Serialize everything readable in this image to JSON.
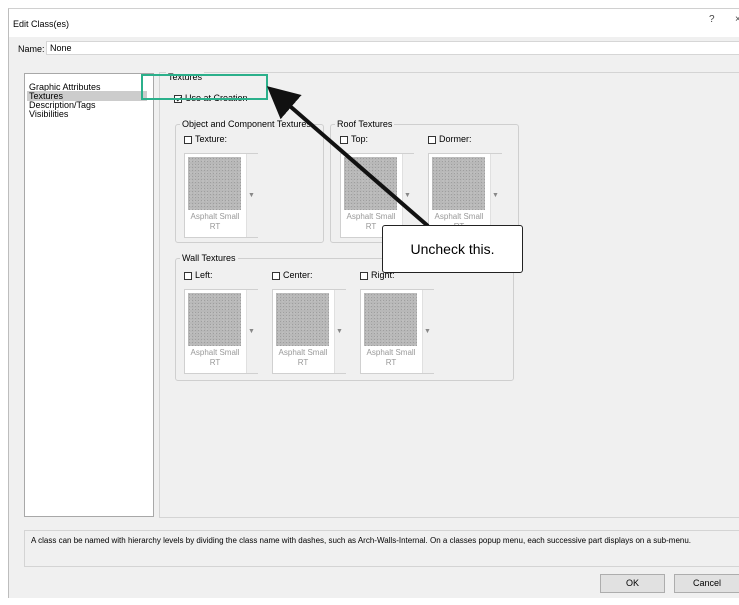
{
  "dialog": {
    "title": "Edit Class(es)",
    "help_label": "?",
    "close_label": "×"
  },
  "name_field": {
    "label": "Name:",
    "value": "None"
  },
  "categories": [
    {
      "label": "Graphic Attributes",
      "selected": false
    },
    {
      "label": "Textures",
      "selected": true
    },
    {
      "label": "Description/Tags",
      "selected": false
    },
    {
      "label": "Visibilities",
      "selected": false
    }
  ],
  "textures": {
    "group_label": "Textures",
    "use_at_creation": {
      "label": "Use at Creation",
      "checked": true
    },
    "object_component": {
      "group_label": "Object and Component Textures",
      "texture": {
        "label": "Texture:",
        "checked": false,
        "name_line1": "Asphalt Small",
        "name_line2": "RT"
      }
    },
    "roof": {
      "group_label": "Roof Textures",
      "top": {
        "label": "Top:",
        "checked": false,
        "name_line1": "Asphalt Small",
        "name_line2": "RT"
      },
      "dormer": {
        "label": "Dormer:",
        "checked": false,
        "name_line1": "Asphalt Small",
        "name_line2": "RT"
      }
    },
    "wall": {
      "group_label": "Wall Textures",
      "left": {
        "label": "Left:",
        "checked": false,
        "name_line1": "Asphalt Small",
        "name_line2": "RT"
      },
      "center": {
        "label": "Center:",
        "checked": false,
        "name_line1": "Asphalt Small",
        "name_line2": "RT"
      },
      "right": {
        "label": "Right:",
        "checked": false,
        "name_line1": "Asphalt Small",
        "name_line2": "RT"
      }
    }
  },
  "hint_text": "A class can be named with hierarchy levels by dividing the class name with dashes, such as Arch-Walls-Internal.  On a classes popup menu, each successive part displays on a sub-menu.",
  "buttons": {
    "ok": "OK",
    "cancel": "Cancel"
  },
  "annotation": {
    "callout_text": "Uncheck this.",
    "highlight_color": "#2bb08b"
  },
  "colors": {
    "dialog_bg": "#f0f0f0",
    "selection_bg": "#cccccc"
  }
}
